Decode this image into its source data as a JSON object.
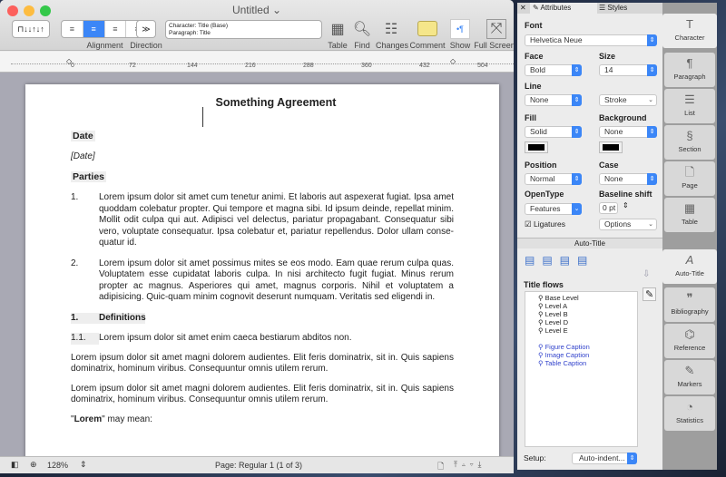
{
  "window": {
    "title": "Untitled"
  },
  "toolbar": {
    "style_box": {
      "character": "Character: Title (Base)",
      "paragraph": "Paragraph: Title"
    },
    "labels": {
      "alignment": "Alignment",
      "direction": "Direction",
      "table": "Table",
      "find": "Find",
      "changes": "Changes",
      "comment": "Comment",
      "show": "Show",
      "fullscreen": "Full Screen"
    },
    "alignment_selected": "center"
  },
  "ruler": {
    "ticks": [
      "0",
      "72",
      "144",
      "216",
      "288",
      "360",
      "432",
      "504"
    ]
  },
  "document": {
    "title": "Something Agreement",
    "date_heading": "Date",
    "date_value": "[Date]",
    "parties_heading": "Parties",
    "items": [
      {
        "num": "1.",
        "text": "Lorem ipsum dolor sit amet cum tenetur animi. Et laboris aut aspexerat fugiat. Ipsa amet quoddam colebatur propter. Qui tempore et magna sibi. Id ipsum deinde, repellat minim. Mollit odit culpa qui aut. Adipisci vel delectus, pariatur propagabant. Consequatur sibi vero, voluptate consequatur. Ipsa colebatur et, pariatur repellendus. Dolor ullam conse-quatur id."
      },
      {
        "num": "2.",
        "text": "Lorem ipsum dolor sit amet possimus mites se eos modo. Eam quae rerum culpa quas. Voluptatem esse cupidatat laboris culpa. In nisi architecto fugit fugiat. Minus rerum propter ac magnus. Asperiores qui amet, magnus corporis. Nihil et voluptatem a adipisicing. Quic-quam minim cognovit deserunt numquam. Veritatis sed eligendi in."
      }
    ],
    "section": {
      "num": "1.",
      "title": "Definitions"
    },
    "subsection": {
      "num": "1.1.",
      "text": "Lorem ipsum dolor sit amet enim caeca bestiarum abditos non."
    },
    "paragraphs": [
      "Lorem ipsum dolor sit amet magni dolorem audientes. Elit feris dominatrix, sit in. Quis sapiens dominatrix, hominum viribus. Consequuntur omnis utilem rerum.",
      "Lorem ipsum dolor sit amet magni dolorem audientes. Elit feris dominatrix, sit in. Quis sapiens dominatrix, hominum viribus. Consequuntur omnis utilem rerum."
    ],
    "lorem_bold": "Lorem",
    "lorem_rest": "\" may mean:",
    "lorem_open": "\""
  },
  "status": {
    "zoom": "128%",
    "page": "Page: Regular 1 (1 of 3)"
  },
  "inspector": {
    "tabs": {
      "attributes": "Attributes",
      "styles": "Styles"
    },
    "font_label": "Font",
    "font": "Helvetica Neue",
    "face_label": "Face",
    "face": "Bold",
    "size_label": "Size",
    "size": "14",
    "line_label": "Line",
    "line": "None",
    "stroke": "Stroke",
    "fill_label": "Fill",
    "fill": "Solid",
    "background_label": "Background",
    "background": "None",
    "fill_color": "#000000",
    "background_color": "#000000",
    "position_label": "Position",
    "position": "Normal",
    "case_label": "Case",
    "case": "None",
    "opentype_label": "OpenType",
    "opentype": "Features",
    "baseline_label": "Baseline shift",
    "baseline": "0 pt",
    "ligatures_label": "Ligatures",
    "ligatures": true,
    "options": "Options"
  },
  "autotitle": {
    "header": "Auto-Title",
    "flows_label": "Title flows",
    "flows": [
      "Base Level",
      "Level A",
      "Level B",
      "Level D",
      "Level E"
    ],
    "captions": [
      "Figure Caption",
      "Image Caption",
      "Table Caption"
    ],
    "setup_label": "Setup:",
    "setup": "Auto-indent..."
  },
  "sidetabs_top": [
    {
      "label": "Character",
      "icon": "T"
    },
    {
      "label": "Paragraph",
      "icon": "¶"
    },
    {
      "label": "List",
      "icon": "☰"
    },
    {
      "label": "Section",
      "icon": "§"
    },
    {
      "label": "Page",
      "icon": "🗋"
    },
    {
      "label": "Table",
      "icon": "▦"
    }
  ],
  "sidetabs_bottom": [
    {
      "label": "Auto-Title",
      "icon": "A"
    },
    {
      "label": "Bibliography",
      "icon": "❞"
    },
    {
      "label": "Reference",
      "icon": "⌬"
    },
    {
      "label": "Markers",
      "icon": "✎"
    },
    {
      "label": "Statistics",
      "icon": "◔"
    }
  ]
}
